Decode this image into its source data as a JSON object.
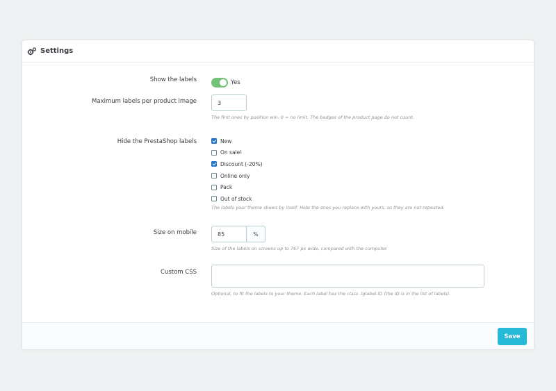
{
  "panel": {
    "title": "Settings",
    "icon": "cogs-icon"
  },
  "show_labels": {
    "label": "Show the labels",
    "state": "Yes",
    "on": true,
    "accent": "#72c279"
  },
  "max_labels": {
    "label": "Maximum labels per product image",
    "value": "3",
    "help": "The first ones by position win. 0 = no limit. The badges of the product page do not count."
  },
  "hide_labels": {
    "label": "Hide the PrestaShop labels",
    "options": [
      {
        "label": "New",
        "checked": true
      },
      {
        "label": "On sale!",
        "checked": false
      },
      {
        "label": "Discount (-20%)",
        "checked": true
      },
      {
        "label": "Online only",
        "checked": false
      },
      {
        "label": "Pack",
        "checked": false
      },
      {
        "label": "Out of stock",
        "checked": false
      }
    ],
    "help": "The labels your theme shows by itself. Hide the ones you replace with yours, so they are not repeated."
  },
  "size_mobile": {
    "label": "Size on mobile",
    "value": "85",
    "unit": "%",
    "help": "Size of the labels on screens up to 767 px wide, compared with the computer."
  },
  "custom_css": {
    "label": "Custom CSS",
    "value": "",
    "help": "Optional, to fit the labels to your theme. Each label has the class .lglabel-ID (the ID is in the list of labels)."
  },
  "footer": {
    "save_label": "Save",
    "button_color": "#25b9d7"
  }
}
